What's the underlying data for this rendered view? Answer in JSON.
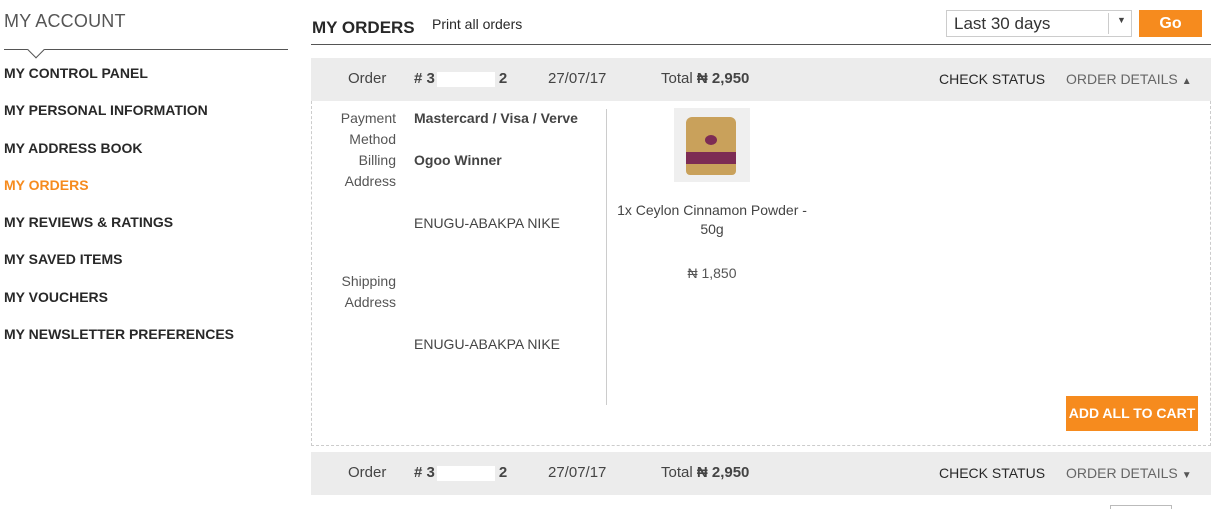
{
  "sidebar": {
    "title": "MY ACCOUNT",
    "items": [
      {
        "label": "MY CONTROL PANEL"
      },
      {
        "label": "MY PERSONAL INFORMATION"
      },
      {
        "label": "MY ADDRESS BOOK"
      },
      {
        "label": "MY ORDERS",
        "active": true
      },
      {
        "label": "MY REVIEWS & RATINGS"
      },
      {
        "label": "MY SAVED ITEMS"
      },
      {
        "label": "MY VOUCHERS"
      },
      {
        "label": "MY NEWSLETTER PREFERENCES"
      }
    ]
  },
  "header": {
    "title": "MY ORDERS",
    "print_link": "Print all orders",
    "period_select": "Last 30 days",
    "go_label": "Go"
  },
  "orders": [
    {
      "label": "Order",
      "number_prefix": "# 3",
      "number_suffix": "2",
      "date": "27/07/17",
      "total_label": "Total",
      "total_value": "₦ 2,950",
      "check_status": "CHECK STATUS",
      "order_details": "ORDER DETAILS",
      "expanded": true,
      "details": {
        "payment_label": "Payment Method",
        "payment_value": "Mastercard / Visa / Verve",
        "billing_label": "Billing Address",
        "billing_name": "Ogoo Winner",
        "billing_city": "ENUGU-ABAKPA NIKE",
        "shipping_label": "Shipping Address",
        "shipping_city": "ENUGU-ABAKPA NIKE",
        "item_name": "1x Ceylon Cinnamon Powder - 50g",
        "item_price": "₦ 1,850",
        "add_all_label": "ADD ALL TO CART"
      }
    },
    {
      "label": "Order",
      "number_prefix": "# 3",
      "number_suffix": "2",
      "date": "27/07/17",
      "total_label": "Total",
      "total_value": "₦ 2,950",
      "check_status": "CHECK STATUS",
      "order_details": "ORDER DETAILS",
      "expanded": false
    }
  ],
  "colors": {
    "accent": "#f68b1e",
    "bar": "#ececec",
    "text": "#282828"
  },
  "icons": {
    "caret_up": "caret-up-icon",
    "caret_down": "caret-down-icon",
    "select_arrow": "chevron-down-icon"
  }
}
